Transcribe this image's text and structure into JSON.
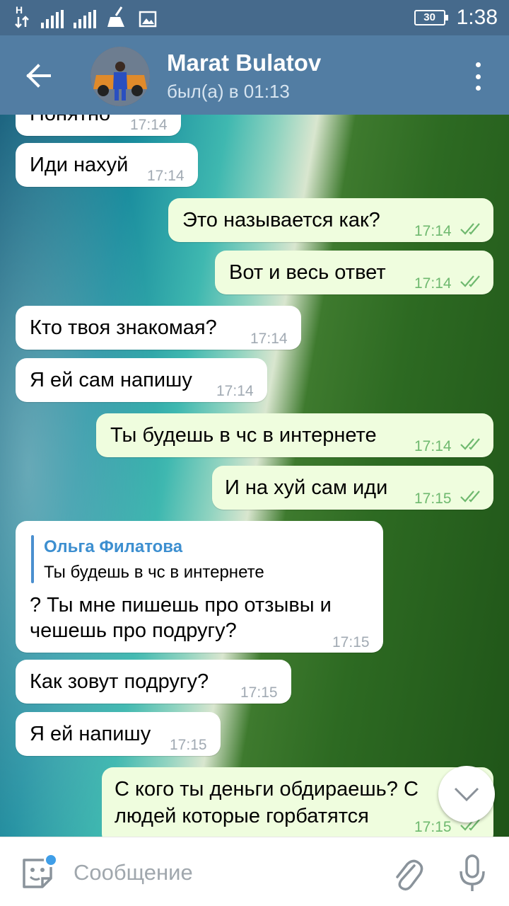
{
  "status_bar": {
    "network": "H",
    "battery": "30",
    "time": "1:38",
    "icons": [
      "signal-icon",
      "signal-icon",
      "cleaner-icon",
      "image-icon"
    ]
  },
  "header": {
    "title": "Marat Bulatov",
    "subtitle": "был(а) в 01:13"
  },
  "messages": [
    {
      "dir": "in",
      "text": "Понятно",
      "time": "17:14"
    },
    {
      "dir": "in",
      "text": "Иди нахуй",
      "time": "17:14"
    },
    {
      "dir": "out",
      "text": "Это называется как?",
      "time": "17:14",
      "read": true
    },
    {
      "dir": "out",
      "text": "Вот и весь ответ",
      "time": "17:14",
      "read": true
    },
    {
      "dir": "in",
      "text": "Кто твоя знакомая?",
      "time": "17:14"
    },
    {
      "dir": "in",
      "text": "Я ей сам напишу",
      "time": "17:14"
    },
    {
      "dir": "out",
      "text": "Ты будешь в чс в интернете",
      "time": "17:14",
      "read": true
    },
    {
      "dir": "out",
      "text": "И на хуй сам иди",
      "time": "17:15",
      "read": true
    },
    {
      "dir": "in",
      "reply_name": "Ольга Филатова",
      "reply_text": "Ты будешь в чс в интернете",
      "line1": "? Ты мне пишешь про отзывы и",
      "line2": "чешешь про подругу?",
      "time": "17:15"
    },
    {
      "dir": "in",
      "text": "Как зовут подругу?",
      "time": "17:15"
    },
    {
      "dir": "in",
      "text": "Я ей напишу",
      "time": "17:15"
    },
    {
      "dir": "out",
      "line1": "С кого ты деньги обдираешь? С",
      "line2": "людей которые горбатятся",
      "time": "17:15",
      "read": true
    }
  ],
  "input": {
    "placeholder": "Сообщение"
  },
  "colors": {
    "header": "#527da3",
    "status_bar": "#466a8c",
    "incoming_bubble": "#ffffff",
    "outgoing_bubble": "#effdde",
    "outgoing_time": "#6fb96f",
    "reply_accent": "#3d8fd0"
  }
}
